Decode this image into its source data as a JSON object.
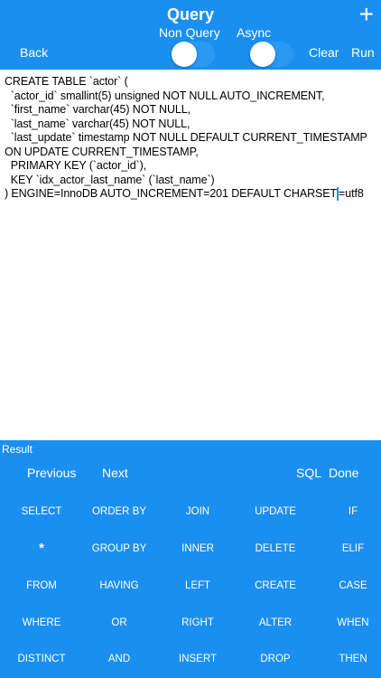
{
  "header": {
    "title": "Query",
    "plus_icon": "plus-icon",
    "back": "Back",
    "clear": "Clear",
    "run": "Run",
    "toggles": {
      "non_query_label": "Non Query",
      "async_label": "Async",
      "non_query_on": false,
      "async_on": false
    },
    "accent_color": "#1b8ff0"
  },
  "editor": {
    "lines": [
      "CREATE TABLE `actor` (",
      "  `actor_id` smallint(5) unsigned NOT NULL AUTO_INCREMENT,",
      "  `first_name` varchar(45) NOT NULL,",
      "  `last_name` varchar(45) NOT NULL,",
      "  `last_update` timestamp NOT NULL DEFAULT CURRENT_TIMESTAMP",
      "ON UPDATE CURRENT_TIMESTAMP,",
      "  PRIMARY KEY (`actor_id`),",
      "  KEY `idx_actor_last_name` (`last_name`)"
    ],
    "last_line_before_cursor": ") ENGINE=InnoDB AUTO_INCREMENT=201 DEFAULT CHARSET",
    "last_line_after_cursor": "=utf8"
  },
  "result": {
    "label": "Result"
  },
  "keyboard": {
    "previous": "Previous",
    "next": "Next",
    "sql": "SQL",
    "done": "Done",
    "rows": [
      [
        "SELECT",
        "ORDER BY",
        "JOIN",
        "UPDATE",
        "IF"
      ],
      [
        "*",
        "GROUP BY",
        "INNER",
        "DELETE",
        "ELIF"
      ],
      [
        "FROM",
        "HAVING",
        "LEFT",
        "CREATE",
        "CASE"
      ],
      [
        "WHERE",
        "OR",
        "RIGHT",
        "ALTER",
        "WHEN"
      ],
      [
        "DISTINCT",
        "AND",
        "INSERT",
        "DROP",
        "THEN"
      ]
    ]
  }
}
